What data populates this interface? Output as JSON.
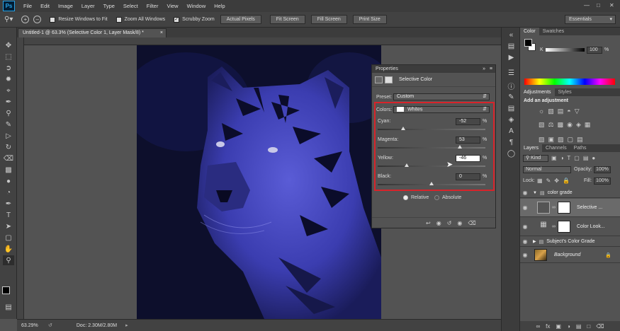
{
  "app": {
    "logo": "Ps",
    "menus": [
      "File",
      "Edit",
      "Image",
      "Layer",
      "Type",
      "Select",
      "Filter",
      "View",
      "Window",
      "Help"
    ]
  },
  "options": {
    "resize_windows": "Resize Windows to Fit",
    "zoom_all": "Zoom All Windows",
    "scrubby": "Scrubby Zoom",
    "actual_pixels": "Actual Pixels",
    "fit_screen": "Fit Screen",
    "fill_screen": "Fill Screen",
    "print_size": "Print Size",
    "workspace": "Essentials"
  },
  "document": {
    "tab_title": "Untitled-1 @ 63.3% (Selective Color 1, Layer Mask/8) *",
    "zoom": "63.29%",
    "doc_info": "Doc: 2.30M/2.80M"
  },
  "properties": {
    "header": "Properties",
    "title": "Selective Color",
    "preset_label": "Preset:",
    "preset_value": "Custom",
    "colors_label": "Colors:",
    "colors_value": "Whites",
    "sliders": [
      {
        "label": "Cyan:",
        "value": "-52",
        "pct": "%",
        "level": -52
      },
      {
        "label": "Magenta:",
        "value": "53",
        "pct": "%",
        "level": 53
      },
      {
        "label": "Yellow:",
        "value": "-46",
        "pct": "%",
        "level": -46
      },
      {
        "label": "Black:",
        "value": "0",
        "pct": "%",
        "level": 0
      }
    ],
    "relative": "Relative",
    "absolute": "Absolute"
  },
  "color_panel": {
    "tab1": "Color",
    "tab2": "Swatches",
    "channel": "K",
    "value": "100",
    "pct": "%"
  },
  "adjustments": {
    "tab1": "Adjustments",
    "tab2": "Styles",
    "subtitle": "Add an adjustment"
  },
  "layers_panel": {
    "tab1": "Layers",
    "tab2": "Channels",
    "tab3": "Paths",
    "kind": "Kind",
    "blend": "Normal",
    "opacity_label": "Opacity:",
    "opacity": "100%",
    "lock_label": "Lock:",
    "fill_label": "Fill:",
    "fill": "100%",
    "layers": [
      {
        "name": "color grade"
      },
      {
        "name": "Selective ..."
      },
      {
        "name": "Color Look..."
      },
      {
        "name": "Subject's Color Grade"
      },
      {
        "name": "Background"
      }
    ]
  },
  "colors": {
    "highlight": "#d8232a",
    "accent": "#2aa3e6"
  }
}
